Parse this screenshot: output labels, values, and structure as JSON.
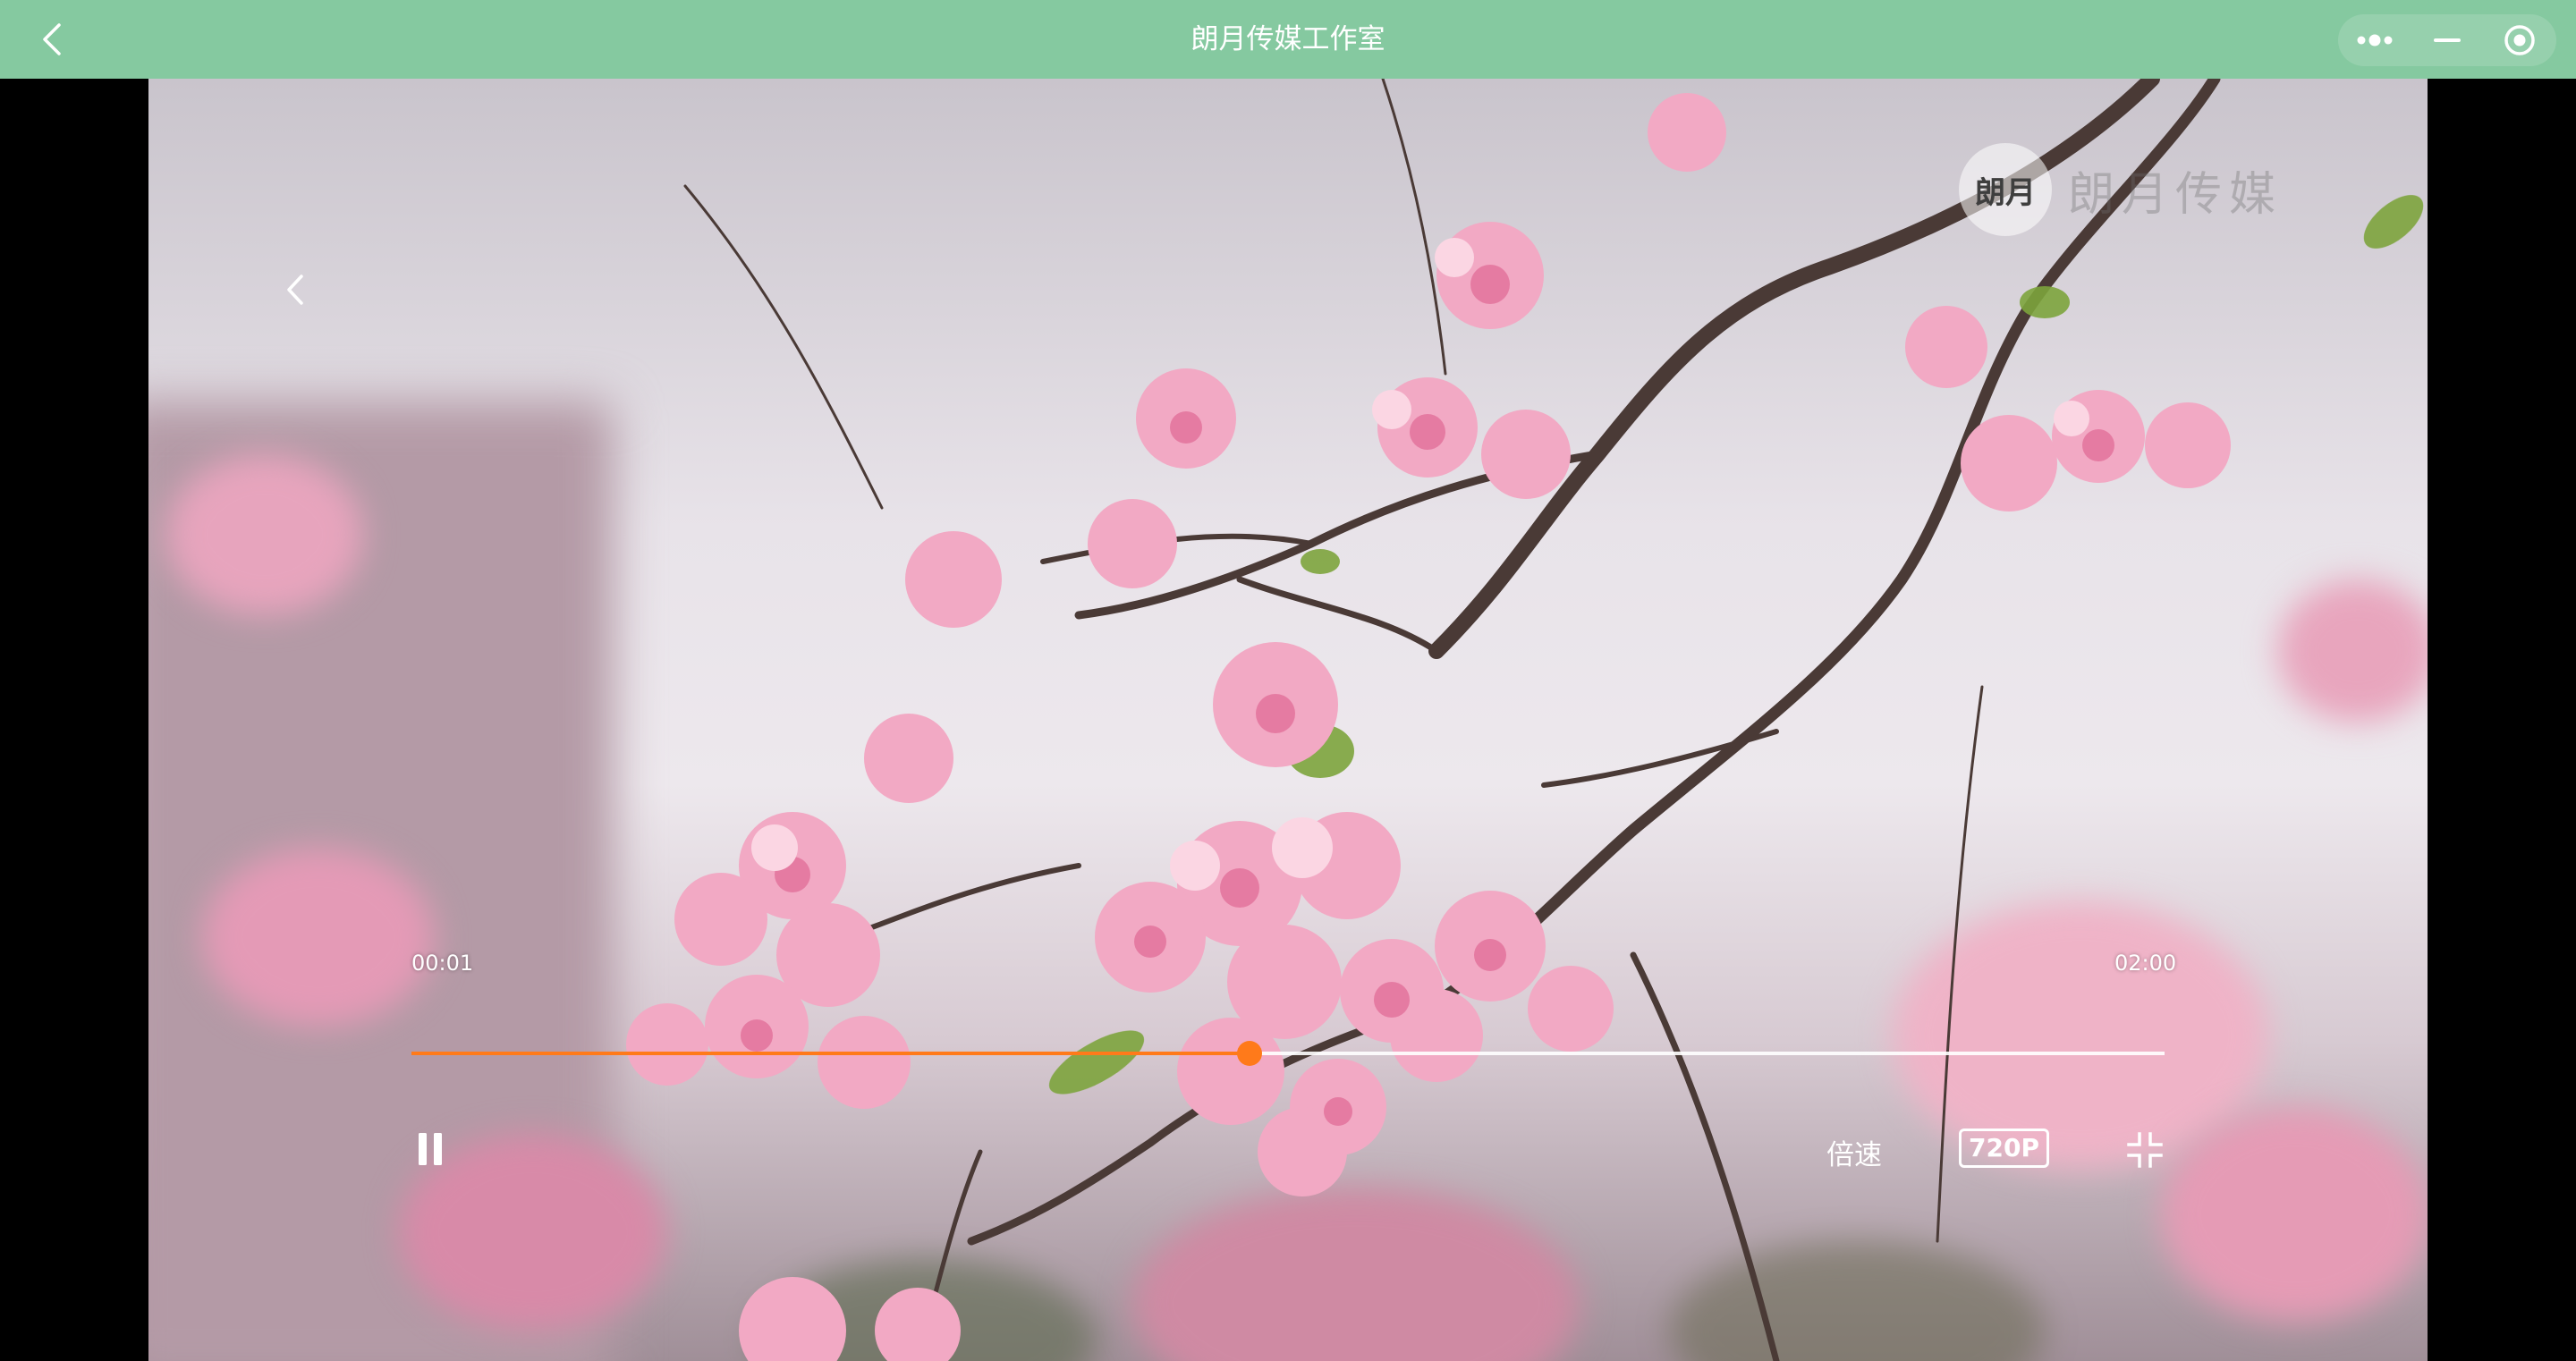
{
  "topbar": {
    "title": "朗月传媒工作室"
  },
  "watermark": {
    "logo_text": "朗月",
    "brand_text": "朗月传媒"
  },
  "player": {
    "current_time": "00:01",
    "duration": "02:00",
    "progress_fraction": 0.478,
    "speed_label": "倍速",
    "quality_label": "720P"
  },
  "colors": {
    "topbar_bg": "#85c9a0",
    "progress_accent": "#ff7a1a"
  }
}
